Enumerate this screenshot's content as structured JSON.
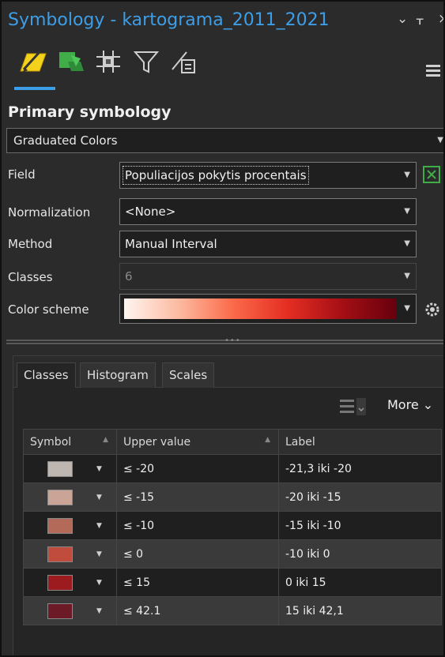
{
  "window": {
    "title": "Symbology - kartograma_2011_2021",
    "controls": [
      "⌄",
      "ᚁ",
      "×"
    ]
  },
  "toolbar": {
    "icons": [
      "primary-symbology-icon",
      "vary-symbology-icon",
      "label-classes-icon",
      "symbol-layer-drawing-icon",
      "masking-icon"
    ],
    "menu": "menu-icon"
  },
  "primary": {
    "heading": "Primary symbology",
    "renderer": "Graduated Colors"
  },
  "fields": {
    "field_label": "Field",
    "field_value": "Populiacijos pokytis procentais",
    "normalization_label": "Normalization",
    "normalization_value": "<None>",
    "method_label": "Method",
    "method_value": "Manual Interval",
    "classes_label": "Classes",
    "classes_value": "6",
    "color_scheme_label": "Color scheme"
  },
  "tabs": [
    "Classes",
    "Histogram",
    "Scales"
  ],
  "more_label": "More ⌄",
  "table": {
    "headers": [
      "Symbol",
      "Upper value",
      "Label"
    ],
    "rows": [
      {
        "color": "#bdb6b1",
        "upper": "≤  -20",
        "label": "-21,3 iki -20"
      },
      {
        "color": "#c9a497",
        "upper": "≤  -15",
        "label": "-20 iki -15"
      },
      {
        "color": "#b46a58",
        "upper": "≤  -10",
        "label": "-15 iki -10"
      },
      {
        "color": "#c04c3e",
        "upper": "≤  0",
        "label": "-10 iki 0"
      },
      {
        "color": "#9b1b1f",
        "upper": "≤  15",
        "label": "0 iki 15"
      },
      {
        "color": "#6b1a26",
        "upper": "≤  42.1",
        "label": "15 iki 42,1"
      }
    ]
  },
  "colors": {
    "accent": "#3d9ee8",
    "background": "#2b2b2b"
  }
}
